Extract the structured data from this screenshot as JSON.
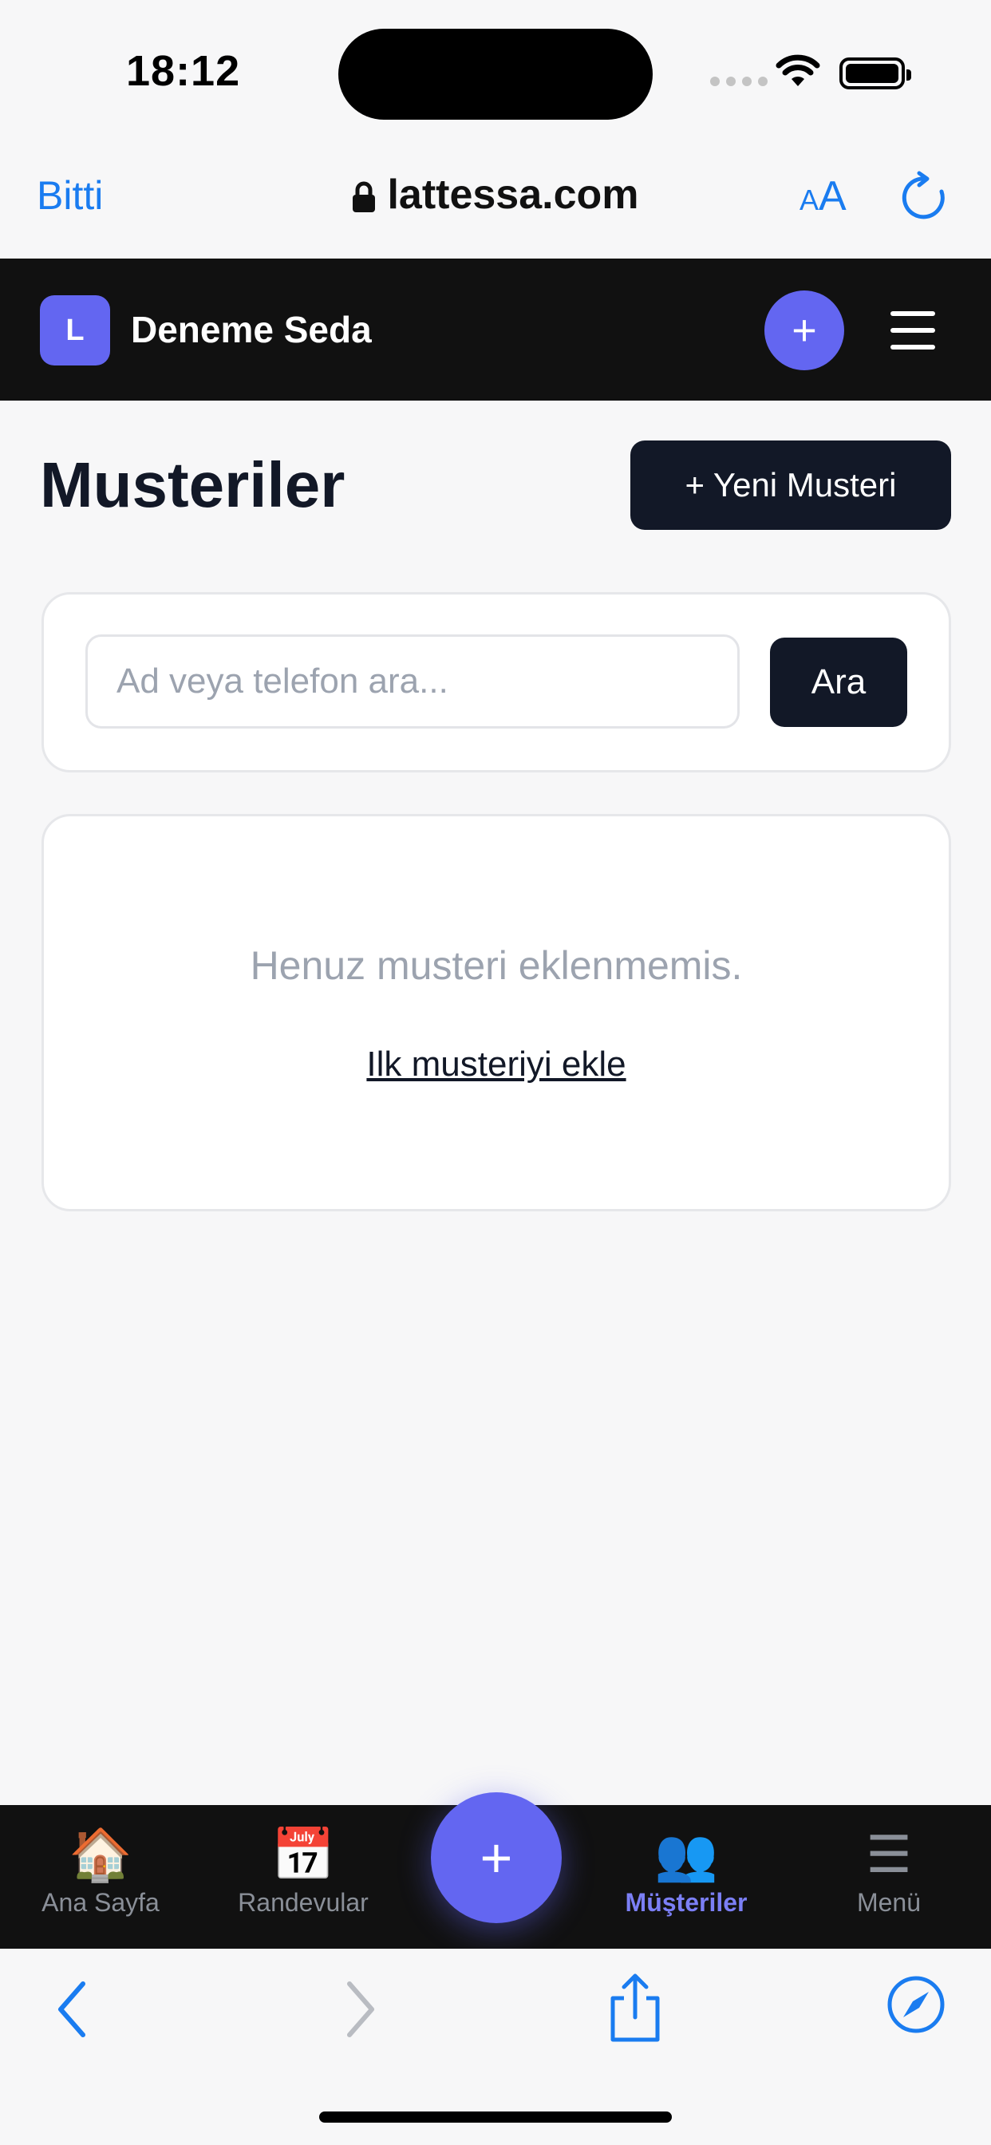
{
  "status": {
    "time": "18:12"
  },
  "browser": {
    "done_label": "Bitti",
    "url": "lattessa.com",
    "text_size_label": "AA"
  },
  "app": {
    "logo_letter": "L",
    "brand": "Deneme Seda",
    "add_symbol": "+"
  },
  "page": {
    "title": "Musteriler",
    "new_button": "+ Yeni Musteri",
    "search_placeholder": "Ad veya telefon ara...",
    "search_button": "Ara",
    "empty_message": "Henuz musteri eklenmemis.",
    "empty_link": "Ilk musteriyi ekle"
  },
  "bottom_nav": {
    "items": [
      {
        "label": "Ana Sayfa",
        "icon": "🏠"
      },
      {
        "label": "Randevular",
        "icon": "📅"
      },
      {
        "label": "Müşteriler",
        "icon": "👥"
      },
      {
        "label": "Menü",
        "icon": "☰"
      }
    ],
    "fab": "+",
    "active_color": "#7b7ff5"
  },
  "colors": {
    "accent": "#6366f1",
    "dark": "#121827",
    "link_blue": "#1a7cf0"
  }
}
